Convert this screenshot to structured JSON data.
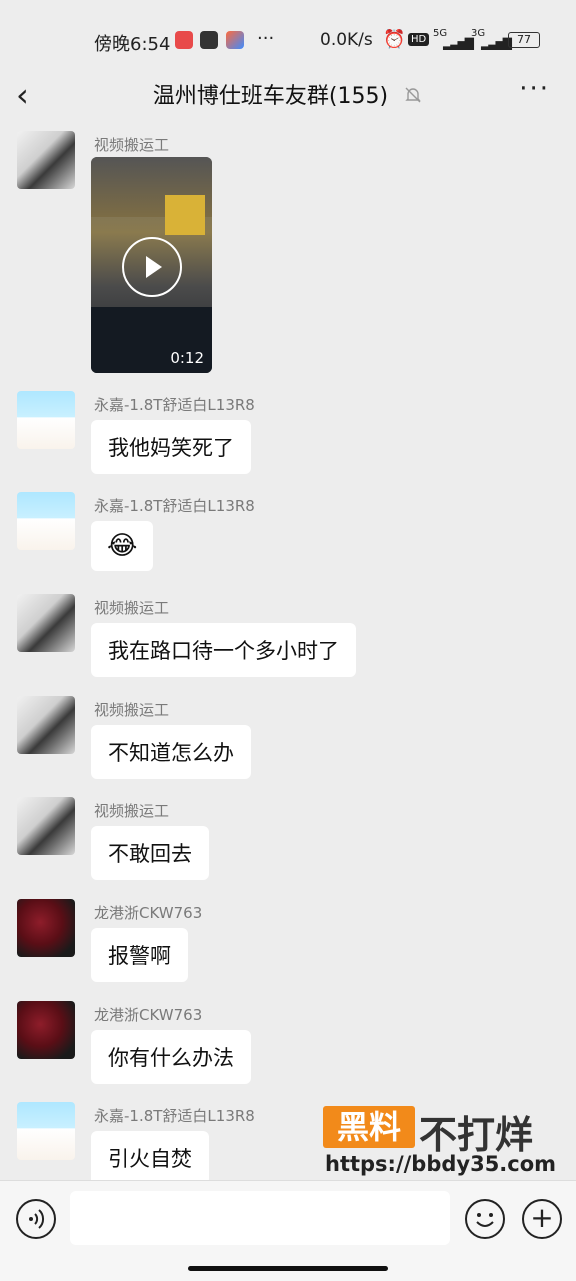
{
  "status_bar": {
    "time": "傍晚6:54",
    "dots": "···",
    "network_speed": "0.0K/s",
    "hd_label": "HD",
    "signal_5g": "5G",
    "signal_3g": "3G",
    "battery": "77"
  },
  "nav": {
    "back_icon": "‹",
    "title": "温州博仕班车友群(155)",
    "more_icon": "···",
    "muted_icon": "bell-off-icon"
  },
  "messages": [
    {
      "sender": "视频搬运工",
      "avatar": "avatar-a",
      "type": "video",
      "duration": "0:12"
    },
    {
      "sender": "永嘉-1.8T舒适白L13R8",
      "avatar": "avatar-b",
      "type": "text",
      "text": "我他妈笑死了"
    },
    {
      "sender": "永嘉-1.8T舒适白L13R8",
      "avatar": "avatar-b",
      "type": "emoji",
      "emoji": "😂"
    },
    {
      "sender": "视频搬运工",
      "avatar": "avatar-a",
      "type": "text",
      "text": "我在路口待一个多小时了"
    },
    {
      "sender": "视频搬运工",
      "avatar": "avatar-a",
      "type": "text",
      "text": "不知道怎么办"
    },
    {
      "sender": "视频搬运工",
      "avatar": "avatar-a",
      "type": "text",
      "text": "不敢回去"
    },
    {
      "sender": "龙港浙CKW763",
      "avatar": "avatar-c",
      "type": "text",
      "text": "报警啊"
    },
    {
      "sender": "龙港浙CKW763",
      "avatar": "avatar-c",
      "type": "text",
      "text": "你有什么办法"
    },
    {
      "sender": "永嘉-1.8T舒适白L13R8",
      "avatar": "avatar-b",
      "type": "text",
      "text": "引火自焚"
    }
  ],
  "watermark": {
    "badge": "黑料",
    "text": "不打烊",
    "url": "https://bbdy35.com"
  },
  "input_bar": {
    "voice_icon": "voice-icon",
    "emoji_icon": "emoji-icon",
    "plus_label": "+"
  },
  "colors": {
    "background": "#ededed",
    "bubble": "#ffffff",
    "watermark_orange": "#f28a1a"
  }
}
